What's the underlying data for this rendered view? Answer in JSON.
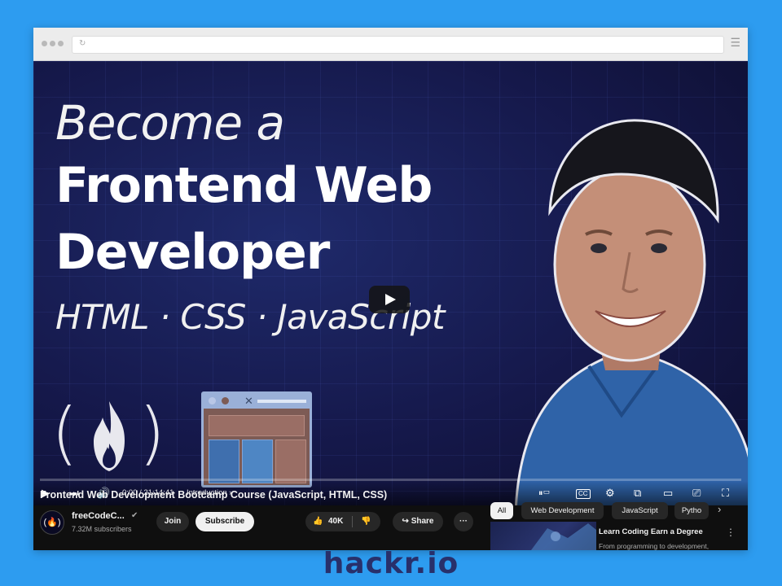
{
  "thumbnail": {
    "line1": "Become a",
    "line2": "Frontend Web",
    "line3": "Developer",
    "line4": "HTML · CSS · JavaScript"
  },
  "player": {
    "time": "0:00 / 21:14:41",
    "chapter": "Introduction",
    "progress": 0,
    "icons": [
      "play-icon",
      "next-icon",
      "volume-icon",
      "autoplay-toggle-icon",
      "cc-icon",
      "settings-icon",
      "miniplayer-icon",
      "theater-icon",
      "cast-icon",
      "fullscreen-icon"
    ],
    "cc_label": "CC"
  },
  "video": {
    "title": "Frontend Web Development Bootcamp Course (JavaScript, HTML, CSS)",
    "channel": "freeCodeC...",
    "subscribers": "7.32M subscribers",
    "join_label": "Join",
    "subscribe_label": "Subscribe",
    "likes": "40K",
    "share_label": "Share",
    "more_label": "···"
  },
  "chips": [
    "All",
    "Web Development",
    "JavaScript",
    "Pytho"
  ],
  "recommendation": {
    "title": "Learn Coding Earn a Degree",
    "subtitle": "From programming to development,"
  },
  "colors": {
    "page_bg": "#2d9cf0",
    "player_bg": "#0f0f0f",
    "thumbnail_bg": "#15184a",
    "progress": "#ff0000",
    "brand": "#28306b"
  },
  "brand": "hackr.io"
}
